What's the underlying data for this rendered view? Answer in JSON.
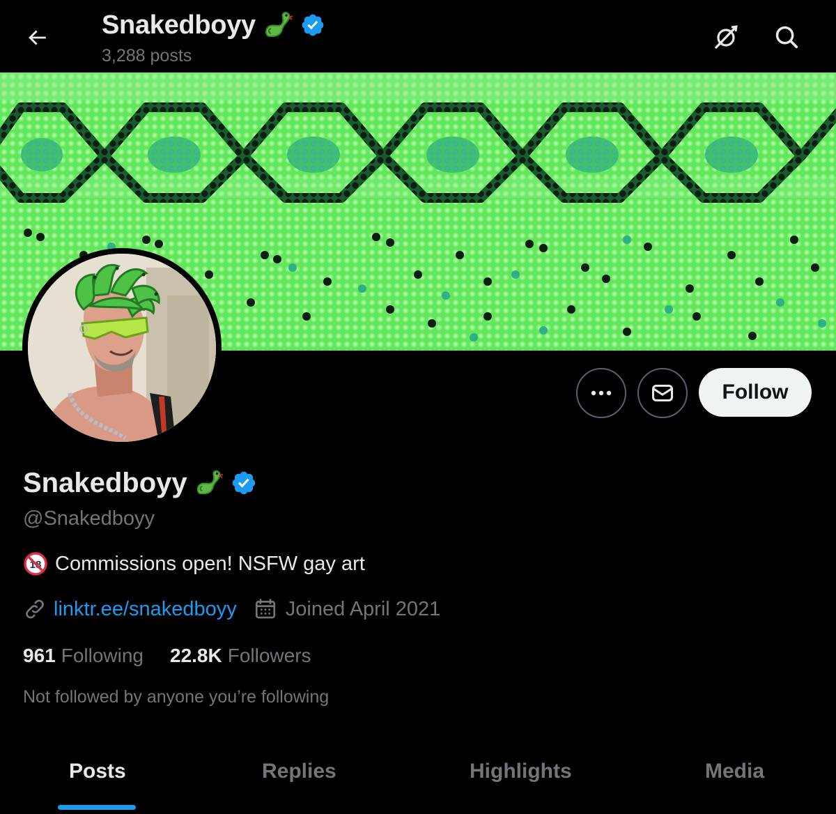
{
  "header": {
    "display_name": "Snakedboyy",
    "post_count": "3,288 posts"
  },
  "profile": {
    "display_name": "Snakedboyy",
    "handle": "@Snakedboyy",
    "bio": "Commissions open! NSFW gay art",
    "bio_emoji": "18",
    "link": "linktr.ee/snakedboyy",
    "joined": "Joined April 2021",
    "following_count": "961",
    "following_label": "Following",
    "followers_count": "22.8K",
    "followers_label": "Followers",
    "mutuals_note": "Not followed by anyone you’re following"
  },
  "actions": {
    "follow_label": "Follow"
  },
  "tabs": [
    {
      "label": "Posts",
      "active": true
    },
    {
      "label": "Replies",
      "active": false
    },
    {
      "label": "Highlights",
      "active": false
    },
    {
      "label": "Media",
      "active": false
    }
  ],
  "icons": {
    "back": "arrow-left-icon",
    "grok": "grok-icon",
    "search": "search-icon",
    "more": "more-icon",
    "message": "envelope-icon",
    "verified": "verified-badge-icon",
    "snake": "snake-emoji-icon",
    "link": "link-icon",
    "calendar": "calendar-icon",
    "no_under_18": "no-under-18-emoji-icon"
  },
  "colors": {
    "background": "#000000",
    "primary_text": "#e7e9ea",
    "secondary_text": "#71767b",
    "accent": "#1d9bf0",
    "follow_button": "#eff3f4",
    "banner_green": "#5ee85a"
  }
}
